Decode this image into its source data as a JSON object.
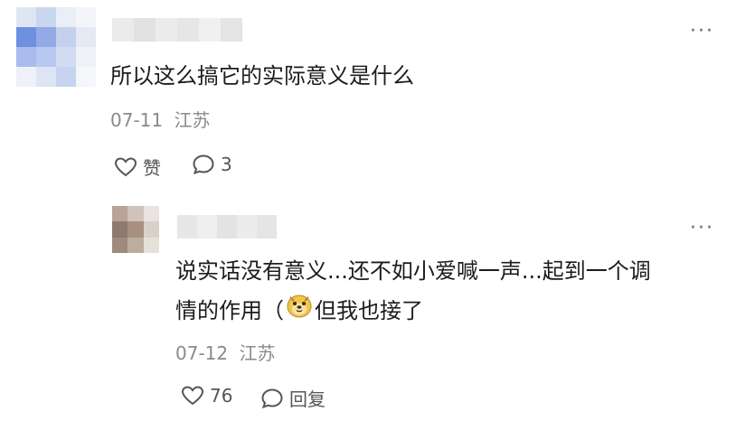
{
  "comment": {
    "text": "所以这么搞它的实际意义是什么",
    "date": "07-11",
    "location": "江苏",
    "like_label": "赞",
    "reply_count": "3",
    "more_label": "···"
  },
  "reply": {
    "text_line1": "说实话没有意义...还不如小爱喊一声...起到一个调",
    "text_line2_before": "情的作用（",
    "text_line2_after": "但我也接了",
    "emoji_icon": "doge-face-emoji",
    "date": "07-12",
    "location": "江苏",
    "like_count": "76",
    "reply_label": "回复",
    "more_label": "···"
  },
  "colors": {
    "text": "#1c1c1c",
    "meta": "#8a8a8a",
    "icon": "#555555"
  }
}
